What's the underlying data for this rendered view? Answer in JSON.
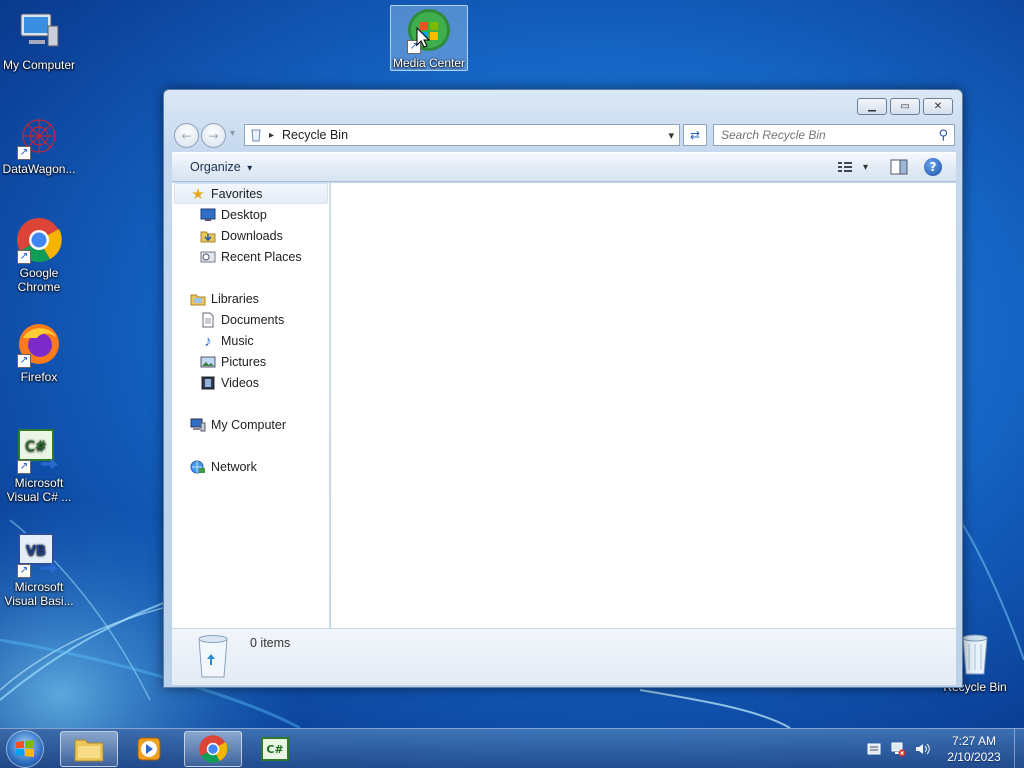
{
  "desktop": {
    "icons": [
      {
        "label": "My Computer",
        "icon": "computer-icon"
      },
      {
        "label": "DataWagon...",
        "icon": "datawagon-icon"
      },
      {
        "label": "Google Chrome",
        "icon": "chrome-icon"
      },
      {
        "label": "Firefox",
        "icon": "firefox-icon"
      },
      {
        "label": "Microsoft Visual C# ...",
        "icon": "visual-csharp-icon"
      },
      {
        "label": "Microsoft Visual Basi...",
        "icon": "visual-basic-icon"
      },
      {
        "label": "Media Center",
        "icon": "media-center-icon"
      },
      {
        "label": "Recycle Bin",
        "icon": "recycle-bin-icon"
      }
    ],
    "shortcut_glyph": "↗"
  },
  "window": {
    "minimize_glyph": "▁",
    "maximize_glyph": "▭",
    "close_glyph": "✕",
    "back_glyph": "←",
    "forward_glyph": "→",
    "history_glyph": "▾",
    "address": {
      "separator": "▸",
      "location": "Recycle Bin",
      "dropdown_glyph": "▾"
    },
    "refresh_glyph": "⇄",
    "search": {
      "placeholder": "Search Recycle Bin",
      "icon": "search-icon",
      "glyph": "⚲"
    },
    "toolbar": {
      "organize": "Organize",
      "organize_arrow": "▾",
      "views_arrow": "▾",
      "help_glyph": "?"
    },
    "nav": {
      "favorites": {
        "label": "Favorites",
        "items": [
          {
            "label": "Desktop",
            "icon": "desktop-icon"
          },
          {
            "label": "Downloads",
            "icon": "downloads-icon"
          },
          {
            "label": "Recent Places",
            "icon": "recent-places-icon"
          }
        ]
      },
      "libraries": {
        "label": "Libraries",
        "items": [
          {
            "label": "Documents",
            "icon": "documents-icon"
          },
          {
            "label": "Music",
            "icon": "music-icon"
          },
          {
            "label": "Pictures",
            "icon": "pictures-icon"
          },
          {
            "label": "Videos",
            "icon": "videos-icon"
          }
        ]
      },
      "computer": "My Computer",
      "network": "Network"
    },
    "details": {
      "count": "0 items"
    }
  },
  "taskbar": {
    "items": [
      "start-button",
      "windows-explorer",
      "media-player",
      "google-chrome",
      "visual-csharp"
    ],
    "csharp_glyph": "C#",
    "clock": {
      "time": "7:27 AM",
      "date": "2/10/2023"
    }
  },
  "colors": {
    "accent": "#1565c5",
    "window_frame": "#c6d9ee",
    "taskbar": "#3a6aa8"
  }
}
